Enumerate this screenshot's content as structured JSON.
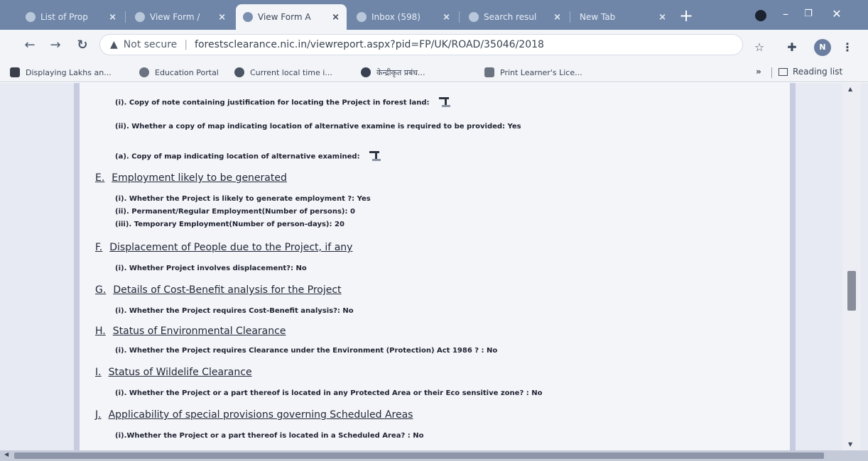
{
  "browser": {
    "tabs": [
      {
        "title": "List of Prop"
      },
      {
        "title": "View Form /"
      },
      {
        "title": "View Form A",
        "active": true
      },
      {
        "title": "Inbox (598)"
      },
      {
        "title": "Search resul"
      },
      {
        "title": "New Tab"
      }
    ],
    "close_glyph": "×",
    "new_tab_glyph": "+",
    "security_label": "Not secure",
    "url": "forestsclearance.nic.in/viewreport.aspx?pid=FP/UK/ROAD/35046/2018",
    "avatar_letter": "N",
    "bookmarks": [
      {
        "label": "Displaying Lakhs an...",
        "icon": "display-icon",
        "color": "#3a3f4a"
      },
      {
        "label": "Education Portal",
        "icon": "education-icon",
        "color": "#6b7280"
      },
      {
        "label": "Current local time i...",
        "icon": "clock-icon",
        "color": "#4b5563"
      },
      {
        "label": "केन्द्रीकृत प्रबंध...",
        "icon": "chrome-icon",
        "color": "#374151"
      },
      {
        "label": "Print Learner's Lice...",
        "icon": "emblem-icon",
        "color": "#6b7280"
      }
    ],
    "bookmarks_more": "»",
    "reading_list_label": "Reading list"
  },
  "document": {
    "items_top": [
      "(i). Copy of note containing justification for locating the Project in forest land:",
      "(ii). Whether a copy of map indicating location of alternative examine is required to be provided: Yes",
      "(a). Copy of map indicating location of alternative examined:"
    ],
    "sections": [
      {
        "letter": "E.",
        "title": "Employment likely to be generated",
        "items": [
          "(i). Whether the Project is likely to generate employment ?: Yes",
          "(ii). Permanent/Regular Employment(Number of persons): 0",
          "(iii). Temporary Employment(Number of person-days): 20"
        ]
      },
      {
        "letter": "F.",
        "title": "Displacement of People due to the Project, if any",
        "items": [
          "(i). Whether Project involves displacement?: No"
        ]
      },
      {
        "letter": "G.",
        "title": "Details of Cost-Benefit analysis for the Project",
        "items": [
          "(i). Whether the Project requires Cost-Benefit analysis?: No"
        ]
      },
      {
        "letter": "H.",
        "title": "Status of Environmental Clearance",
        "items": [
          "(i). Whether the Project requires Clearance under the Environment (Protection) Act 1986 ? : No"
        ]
      },
      {
        "letter": "I.",
        "title": "Status of Wildelife Clearance",
        "items": [
          "(i). Whether the Project or a part thereof is located in any Protected Area or their Eco sensitive zone? : No"
        ]
      },
      {
        "letter": "J.",
        "title": "Applicability of special provisions governing Scheduled Areas",
        "items": [
          "(i).Whether the Project or a part thereof is located in a Scheduled Area? : No"
        ]
      }
    ]
  }
}
